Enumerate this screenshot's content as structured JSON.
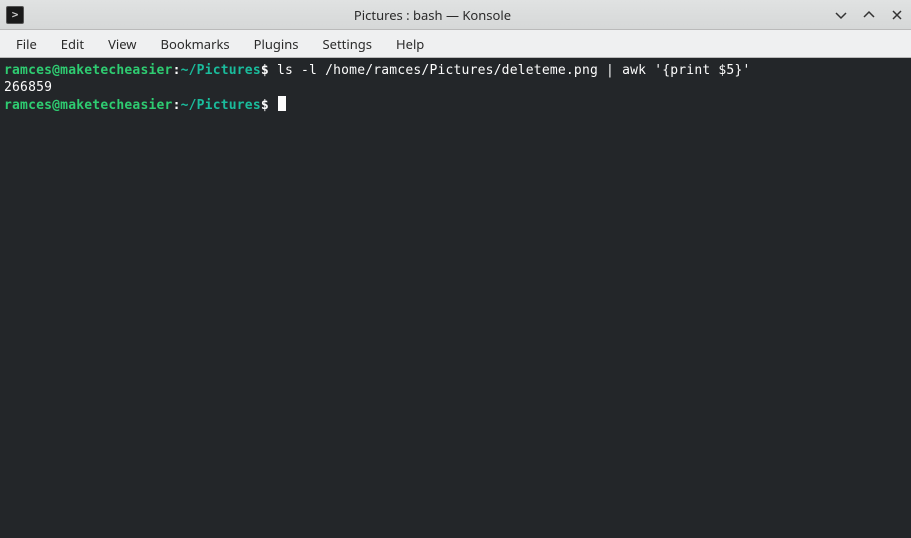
{
  "window": {
    "title": "Pictures : bash — Konsole",
    "icon_glyph": ">_"
  },
  "menubar": {
    "items": [
      "File",
      "Edit",
      "View",
      "Bookmarks",
      "Plugins",
      "Settings",
      "Help"
    ]
  },
  "terminal": {
    "lines": [
      {
        "type": "prompt",
        "user": "ramces@maketecheasier",
        "path": "~/Pictures",
        "command": "ls -l /home/ramces/Pictures/deleteme.png | awk '{print $5}'"
      },
      {
        "type": "output",
        "text": "266859"
      },
      {
        "type": "prompt",
        "user": "ramces@maketecheasier",
        "path": "~/Pictures",
        "command": "",
        "cursor": true
      }
    ]
  }
}
